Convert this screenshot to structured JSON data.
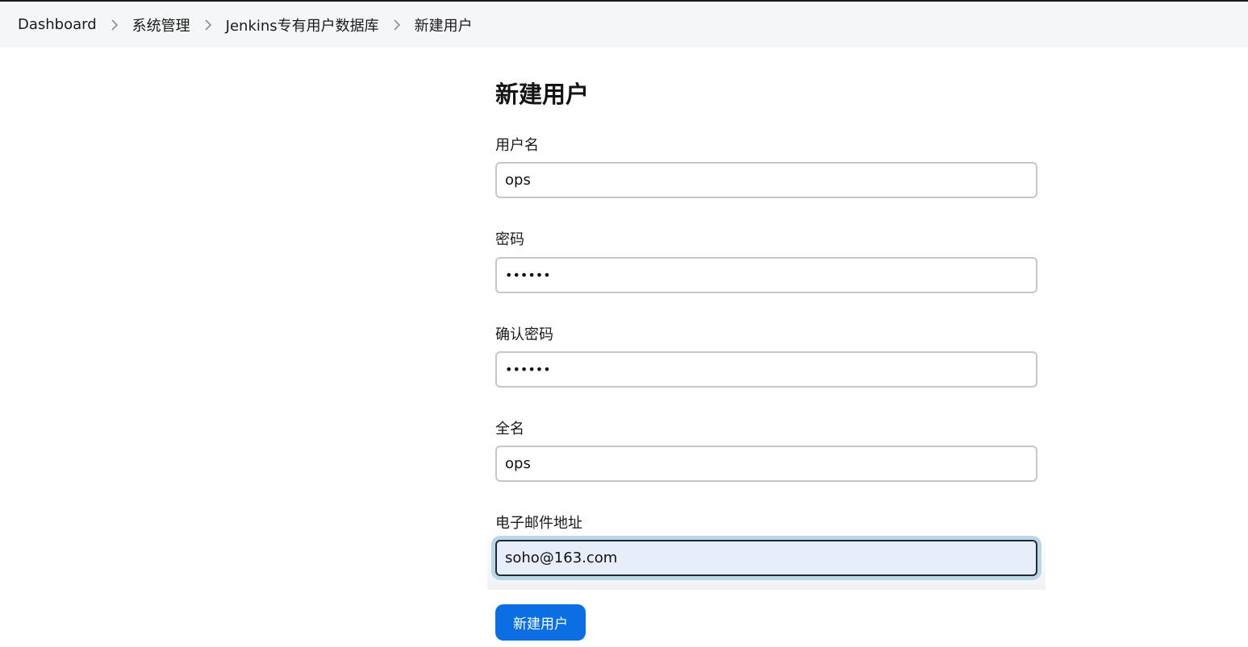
{
  "breadcrumb": {
    "items": [
      "Dashboard",
      "系统管理",
      "Jenkins专有用户数据库",
      "新建用户"
    ]
  },
  "page": {
    "title": "新建用户"
  },
  "form": {
    "username": {
      "label": "用户名",
      "value": "ops"
    },
    "password": {
      "label": "密码",
      "value": "••••••"
    },
    "confirm_password": {
      "label": "确认密码",
      "value": "••••••"
    },
    "fullname": {
      "label": "全名",
      "value": "ops"
    },
    "email": {
      "label": "电子邮件地址",
      "value": "soho@163.com"
    },
    "submit_label": "新建用户"
  },
  "colors": {
    "accent": "#0b6fe3",
    "breadcrumb_bg": "#f5f6f8",
    "focus_bg": "#e8eef9"
  },
  "icons": {
    "breadcrumb_separator": "chevron-right-icon"
  }
}
